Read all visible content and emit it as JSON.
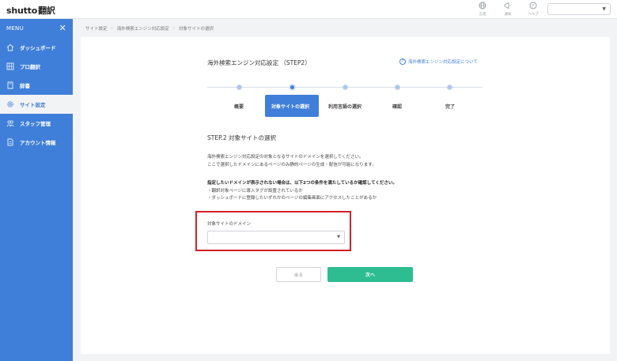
{
  "app": {
    "logo_en": "shutto",
    "logo_ja": "翻訳"
  },
  "topbar": {
    "icons": [
      {
        "icon": "globe-icon",
        "label": "言語"
      },
      {
        "icon": "megaphone-icon",
        "label": "通知"
      },
      {
        "icon": "help-icon",
        "label": "ヘルプ"
      }
    ],
    "select_value": ""
  },
  "sidebar": {
    "menu_label": "MENU",
    "items": [
      {
        "label": "ダッシュボード",
        "icon": "home-icon"
      },
      {
        "label": "プロ翻訳",
        "icon": "grid-icon"
      },
      {
        "label": "辞書",
        "icon": "book-icon"
      },
      {
        "label": "サイト設定",
        "icon": "gear-icon",
        "active": true
      },
      {
        "label": "スタッフ管理",
        "icon": "users-icon"
      },
      {
        "label": "アカウント情報",
        "icon": "document-icon"
      }
    ]
  },
  "breadcrumb": [
    "サイト設定",
    "海外検索エンジン対応設定",
    "対象サイトの選択"
  ],
  "main": {
    "title": "海外検索エンジン対応設定 （STEP2）",
    "help_link": "海外検索エンジン対応設定について",
    "steps": [
      "概要",
      "対象サイトの選択",
      "利用言語の選択",
      "確認",
      "完了"
    ],
    "current_step_index": 1,
    "sub_title": "STEP.2 対象サイトの選択",
    "description": [
      "海外検索エンジン対応設定の対象となるサイトのドメインを選択してください。",
      "ここで選択したドメインにあるページのみ静的ページの生成・配信が可能になります。"
    ],
    "warning_title": "指定したいドメインが表示されない場合は、以下2つの条件を満たしているか確認してください。",
    "warning_items": [
      "・翻訳対象ページに導入タグが設置されているか",
      "・ダッシュボードに登録したいずれかのページの編集画面にアクセスしたことがあるか"
    ],
    "domain_label": "対象サイトのドメイン",
    "domain_value": "",
    "back_button": "戻る",
    "next_button": "次へ"
  },
  "colors": {
    "primary": "#3f7fd9",
    "next_button": "#2dbd90",
    "highlight": "#d42026"
  }
}
